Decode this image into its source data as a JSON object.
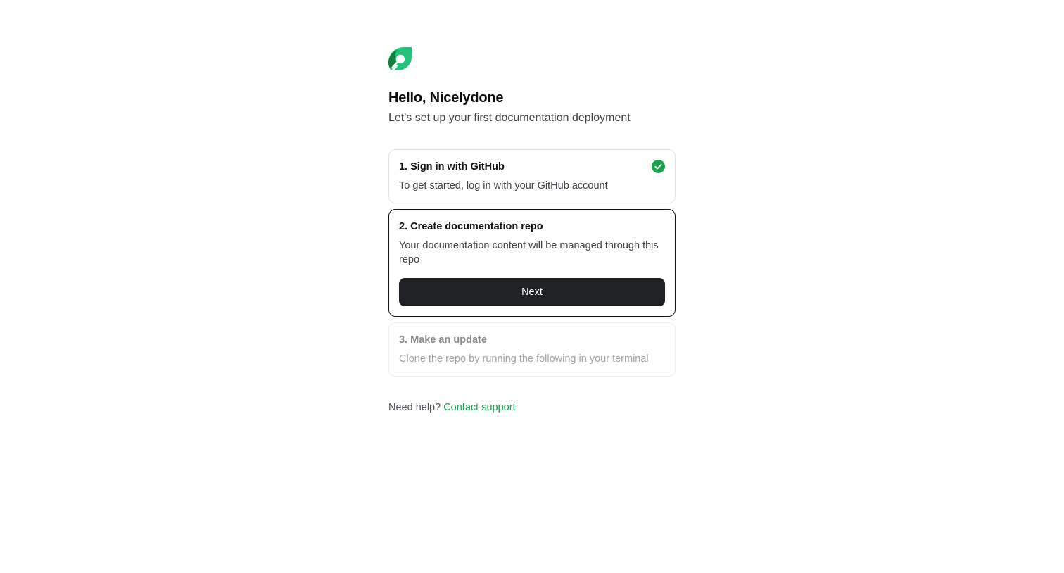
{
  "header": {
    "greeting": "Hello, Nicelydone",
    "subtitle": "Let's set up your first documentation deployment"
  },
  "steps": [
    {
      "title": "1. Sign in with GitHub",
      "description": "To get started, log in with your GitHub account",
      "status": "completed",
      "status_icon": "check-circle-icon"
    },
    {
      "title": "2. Create documentation repo",
      "description": "Your documentation content will be managed through this repo",
      "status": "active",
      "button_label": "Next"
    },
    {
      "title": "3. Make an update",
      "description": "Clone the repo by running the following in your terminal",
      "status": "disabled"
    }
  ],
  "help": {
    "prefix": "Need help?",
    "link_label": "Contact support"
  },
  "colors": {
    "brand_green": "#16a34a",
    "button_bg": "#202124"
  },
  "icons": {
    "logo": "leaf-logo-icon"
  }
}
